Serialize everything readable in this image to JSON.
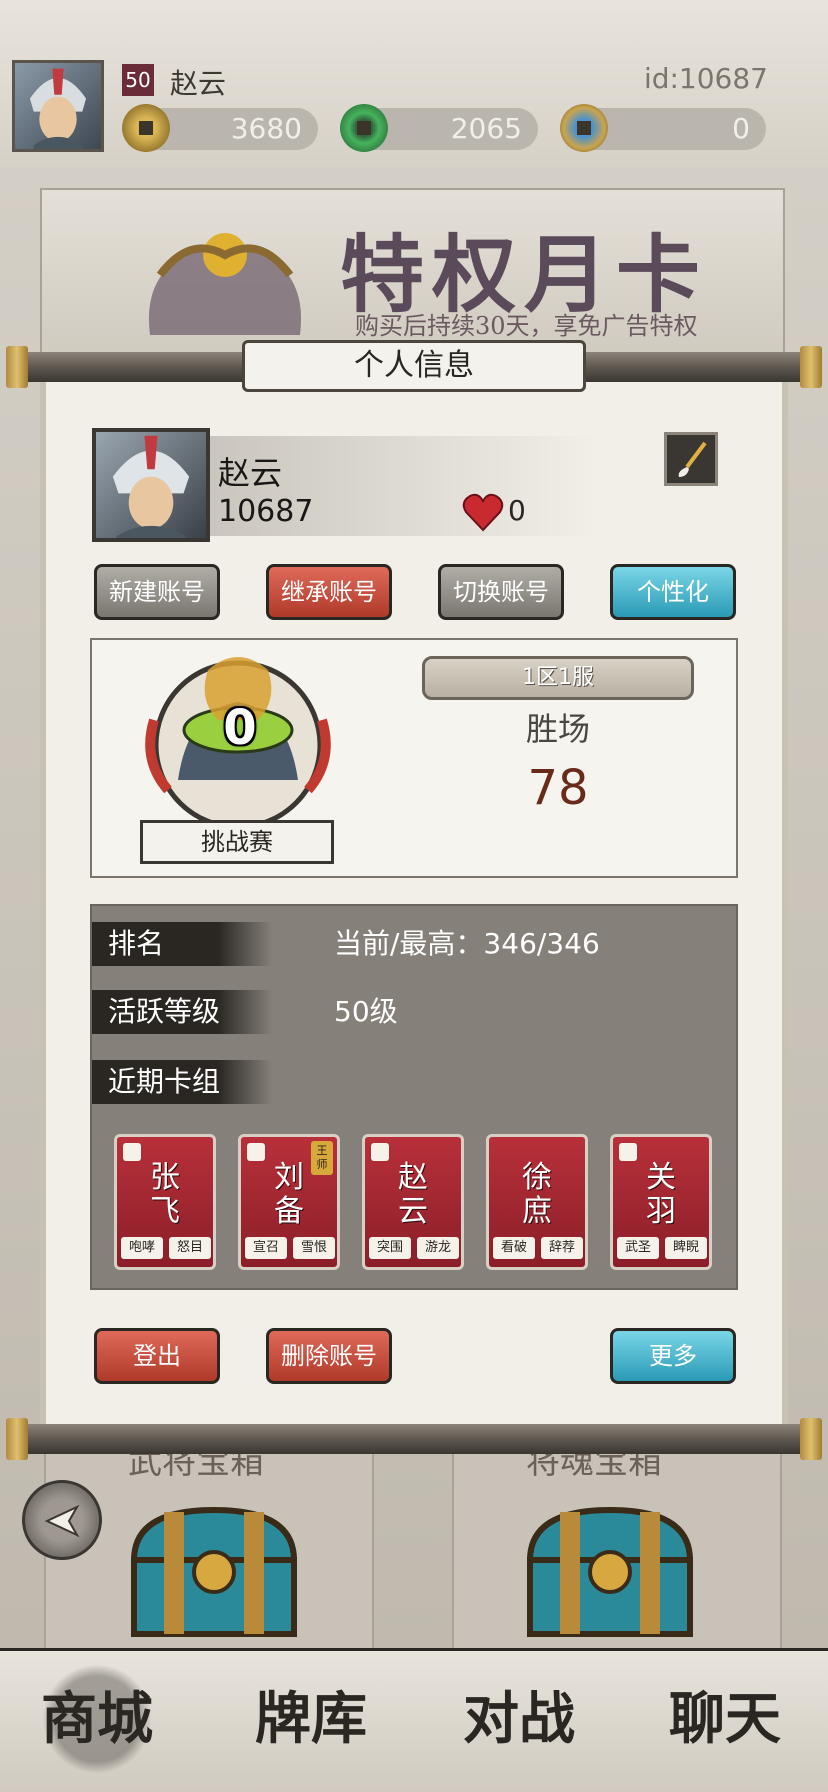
{
  "top_bar": {
    "level": "50",
    "name": "赵云",
    "user_id": "id:10687",
    "currencies": [
      {
        "icon": "gold-coin-icon",
        "value": "3680"
      },
      {
        "icon": "jade-coin-icon",
        "value": "2065"
      },
      {
        "icon": "gem-coin-icon",
        "value": "0"
      }
    ]
  },
  "background": {
    "promo_title": "特权月卡",
    "promo_subtitle": "购买后持续30天，享免广告特权",
    "chest_left_label": "武将宝箱",
    "chest_right_label": "将魂宝箱"
  },
  "bottom_nav": {
    "items": [
      "商城",
      "牌库",
      "对战",
      "聊天"
    ],
    "active": "商城"
  },
  "modal": {
    "title": "个人信息",
    "profile": {
      "name": "赵云",
      "id": "10687",
      "likes": "0"
    },
    "account_buttons": {
      "new": "新建账号",
      "inherit": "继承账号",
      "switch": "切换账号",
      "personalize": "个性化"
    },
    "battle": {
      "medal_value": "0",
      "mode_label": "挑战赛",
      "server": "1区1服",
      "wins_label": "胜场",
      "wins_value": "78"
    },
    "stats": {
      "rank_label": "排名",
      "rank_value": "当前/最高：346/346",
      "activity_label": "活跃等级",
      "activity_value": "50级",
      "deck_label": "近期卡组"
    },
    "deck": [
      {
        "name": "张飞",
        "skills": [
          "咆哮",
          "怒目"
        ]
      },
      {
        "name": "刘备",
        "skills": [
          "宣召",
          "雪恨"
        ],
        "tag": "王师"
      },
      {
        "name": "赵云",
        "skills": [
          "突围",
          "游龙"
        ]
      },
      {
        "name": "徐庶",
        "skills": [
          "看破",
          "辞荐"
        ]
      },
      {
        "name": "关羽",
        "skills": [
          "武圣",
          "睥睨"
        ]
      }
    ],
    "footer_buttons": {
      "logout": "登出",
      "delete": "删除账号",
      "more": "更多"
    }
  },
  "colors": {
    "button_red": "#c84a3a",
    "button_cyan": "#3ab0cc",
    "button_grey": "#9a958e",
    "card_red": "#a82832",
    "wins_text": "#6a2a1a"
  }
}
